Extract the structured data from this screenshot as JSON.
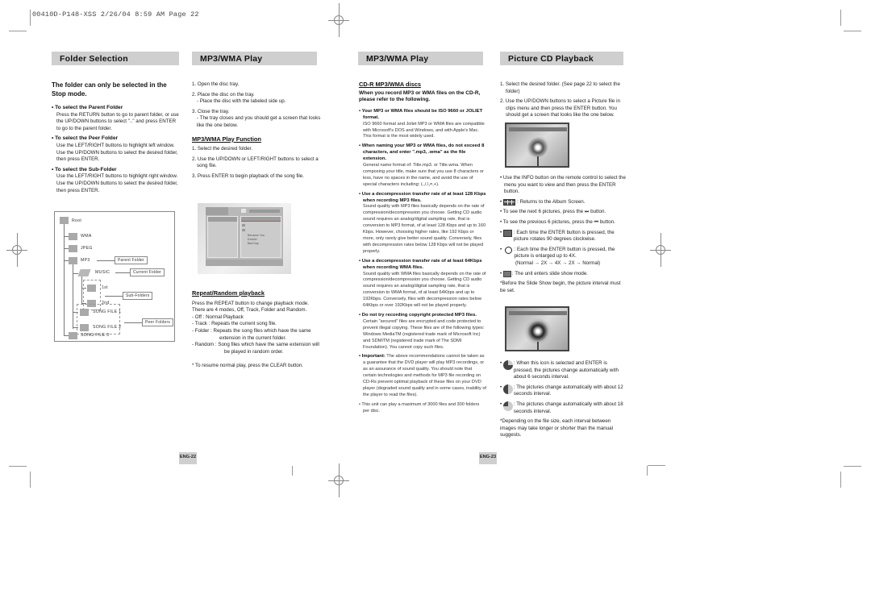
{
  "slug": "00410D-P148-XSS  2/26/04 8:59 AM  Page 22",
  "left_page": {
    "col1": {
      "header": "Folder Selection",
      "lead": "The folder can only be selected in the Stop mode.",
      "items": [
        {
          "title": "• To select the Parent Folder",
          "body": "Press the RETURN button to go to parent folder, or use the UP/DOWN buttons to select \"..\" and press ENTER to go to the parent folder."
        },
        {
          "title": "• To select the Peer Folder",
          "body": "Use the LEFT/RIGHT buttons to highlight left window. Use the UP/DOWN buttons to select the desired folder, then press ENTER."
        },
        {
          "title": "• To select the Sub-Folder",
          "body": "Use the LEFT/RIGHT buttons to highlight right window. Use the UP/DOWN buttons to select the desired folder, then press ENTER."
        }
      ],
      "tree": {
        "nodes": [
          "Root",
          "WMA",
          "JPEG",
          "MP3",
          "MUSIC",
          "1st",
          "2nd",
          "SONG FILE 1",
          "SONG FILE 2",
          "SONG FILE 3"
        ],
        "labels": {
          "parent": "Parent Folder",
          "current": "Current Folder",
          "sub": "Sub-Folders",
          "peer": "Peer Folders"
        }
      }
    },
    "col2": {
      "header": "MP3/WMA Play",
      "steps": [
        {
          "text": "1. Open the disc tray."
        },
        {
          "text": "2. Place the disc on the tray.",
          "sub": "- Place the disc with the labeled side up."
        },
        {
          "text": "3. Close the tray.",
          "sub": "- The tray closes and you should get a screen that looks like the one below."
        }
      ],
      "function_title": "MP3/WMA Play Function",
      "function_steps": [
        "1. Select the desired folder.",
        "2. Use the UP/DOWN or LEFT/RIGHT buttons to select a song file.",
        "3. Press ENTER to begin playback of the song file."
      ],
      "screen": {
        "tracks": [
          "Because You",
          "Ezekiel",
          "Bad Day"
        ]
      },
      "repeat_title": "Repeat/Random playback",
      "repeat_intro": "Press the REPEAT button to change playback mode. There are 4 modes, Off, Track, Folder and Random.",
      "modes": [
        "- Off : Normal Playback",
        "- Track : Repeats the current song file.",
        "- Folder : Repeats the song files which have the same extension in the current folder.",
        "- Random : Song files which have the same extension will be played in random order."
      ],
      "note": "* To resume normal play, press the CLEAR button."
    },
    "page_number": "ENG-22"
  },
  "right_page": {
    "col3": {
      "header": "MP3/WMA Play",
      "title": "CD-R MP3/WMA discs",
      "lead": "When you record MP3 or WMA files on the CD-R, please refer to the following.",
      "items": [
        {
          "title": "• Your MP3 or WMA files should be ISO 9660 or JOLIET format.",
          "body": "ISO 9660 format and Joliet MP3 or WMA files are compatible with Microsoft's DOS and Windows, and with Apple's Mac. This format is the most widely used."
        },
        {
          "title": "• When naming your MP3 or WMA files, do not exceed 8 characters, and enter \".mp3, .wma\" as the file extension.",
          "body": "General name format of: Title.mp3. or Title.wma. When composing your title, make sure that you use 8 characters or less, have no spaces in the name, and avoid the use of special characters including: (.,/,\\,=,+)."
        },
        {
          "title": "• Use a decompression transfer rate of at least 128 Kbps when recording MP3 files.",
          "body": "Sound quality with MP3 files basically depends on the rate of compression/decompression you choose. Getting CD audio sound requires an analog/digital sampling rate, that is conversion to MP3 format, of at least 128 Kbps and up to 160 Kbps. However, choosing higher rates, like 192 Kbps or more, only rarely give better sound quality. Conversely, files with decompression rates below 128 Kbps will not be played properly."
        },
        {
          "title": "• Use a decompression transfer rate of at least 64Kbps when recording WMA files.",
          "body": "Sound quality with WMA files basically depends on the rate of compression/decompression you choose. Getting CD audio sound requires an analog/digital sampling rate, that is conversion to WMA format, of at least 64Kbps and up to 192Kbps. Conversely, files with decompression rates below 64Kbps or over 192Kbps will not be played properly."
        },
        {
          "title": "• Do not try recording copyright protected MP3 files.",
          "body": "Certain \"secured\" files are encrypted and code protected to prevent illegal copying. These files are of the following types: Windows MediaTM (registered trade mark of Microsoft Inc) and SDMITM (registered trade mark of The SDMI Foundation). You cannot copy such files."
        }
      ],
      "important_label": "• Important:",
      "important_body": " The above recommendations cannot be taken as a guarantee that the DVD player will play MP3 recordings, or as an assurance of sound quality. You should note that certain technologies and methods for MP3 file recording on CD-Rs prevent optimal playback of these files on your DVD player (degraded sound quality and in some cases, inability of the player to read the files).",
      "capacity": "• This unit can play a maximum of 3000 files and 300 folders per disc."
    },
    "col4": {
      "header": "Picture CD Playback",
      "steps": [
        "1. Select the desired folder. (See page 22 to select the folder)",
        "2. Use the UP/DOWN buttons to select a Picture file in clips menu and then press the ENTER button. You should get a screen that looks like the one below."
      ],
      "info": "• Use the INFO button on the remote control to select the menu you want to view and then press the ENTER button.",
      "album": ": Returns to the Album Screen.",
      "next": "• To see the next 6 pictures, press the ⏭ button.",
      "prev": "• To see the previous 6 pictures, press the ⏮ button.",
      "rotate": ": Each time the ENTER button is pressed, the picture rotates 90 degrees clockwise.",
      "zoom": ": Each time the ENTER button is pressed, the picture is enlarged up to 4X.",
      "zoom_seq": "(Normal → 2X → 4X → 2X → Normal)",
      "slideshow": ": The unit enters slide show mode.",
      "slideshow_note": "*Before the Slide Show begin, the picture interval must be set.",
      "intervals": [
        ": When this icon is selected and ENTER is pressed, the pictures change automatically with about 6 seconds interval.",
        ": The pictures change automatically with about 12 seconds interval.",
        ": The pictures change automatically with about 18 seconds interval."
      ],
      "footnote": "*Depending on the file size, each interval between images may take longer or shorter than the manual suggests."
    },
    "page_number": "ENG-23"
  }
}
